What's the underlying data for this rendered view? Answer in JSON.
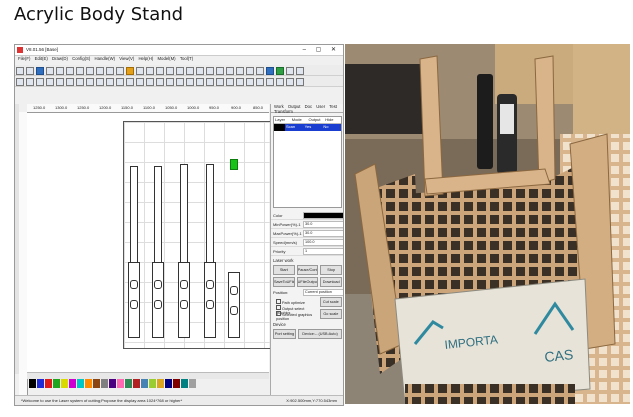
{
  "page": {
    "heading": "Acrylic Body Stand"
  },
  "software": {
    "window_title": "V8.01.56 [Base]",
    "window_controls": [
      "–",
      "▢",
      "✕"
    ],
    "menu": [
      "File(F)",
      "Edit(E)",
      "Draw(D)",
      "Config(S)",
      "Handle(W)",
      "View(V)",
      "Help(H)",
      "Model(M)",
      "Tool(T)"
    ],
    "ruler_ticks": [
      "1250.0",
      "1300.0",
      "1250.0",
      "1200.0",
      "1150.0",
      "1100.0",
      "1050.0",
      "1000.0",
      "950.0",
      "900.0",
      "850.0"
    ],
    "panel": {
      "tabs": [
        "Work",
        "Output",
        "Doc",
        "User",
        "Test",
        "Transform"
      ],
      "layer_columns": [
        "Layer",
        "Mode",
        "Output",
        "Hide"
      ],
      "layer_row": {
        "mode": "Scan",
        "output": "Yes",
        "hide": "No"
      },
      "params": [
        {
          "label": "Color",
          "value": ""
        },
        {
          "label": "MinPower(%)-1",
          "value": "30.0"
        },
        {
          "label": "MaxPower(%)-1",
          "value": "30.0"
        },
        {
          "label": "Speed(mm/s)",
          "value": "100.0"
        },
        {
          "label": "Priority",
          "value": "1"
        }
      ],
      "laser_work_label": "Laser work",
      "buttons_row1": [
        "Start",
        "Pause/Continue",
        "Stop"
      ],
      "buttons_row2": [
        "SaveToUFile",
        "UFileOutput",
        "Download"
      ],
      "position_label": "Position:",
      "position_value": "Current position",
      "path_optimize": "Path optimize",
      "output_select": "Output select graphics",
      "selected_graphics": "Selected graphics position",
      "cut_scale": "Cut scale",
      "go_scale": "Go scale",
      "device_label": "Device",
      "port_setting": "Port setting",
      "device_value": "Device:-- (USB:Auto)"
    },
    "status_left": "*Welcome to use the Laser system of cutting;Propose the display area 1024*768 or higher*",
    "status_right": "X:902.500mm,Y:770.543mm",
    "palette": [
      "#000000",
      "#1f2bd6",
      "#e01b1b",
      "#1fa51f",
      "#d9d900",
      "#d000d0",
      "#00c8c8",
      "#ff8c00",
      "#8b4513",
      "#808080",
      "#4b0082",
      "#ff69b4",
      "#2e8b57",
      "#b22222",
      "#4682b4",
      "#9acd32",
      "#daa520",
      "#000080",
      "#800000",
      "#008080",
      "#a0a0a0"
    ]
  },
  "photo": {
    "text_a": "IMPORTA",
    "text_b": "CAS"
  }
}
